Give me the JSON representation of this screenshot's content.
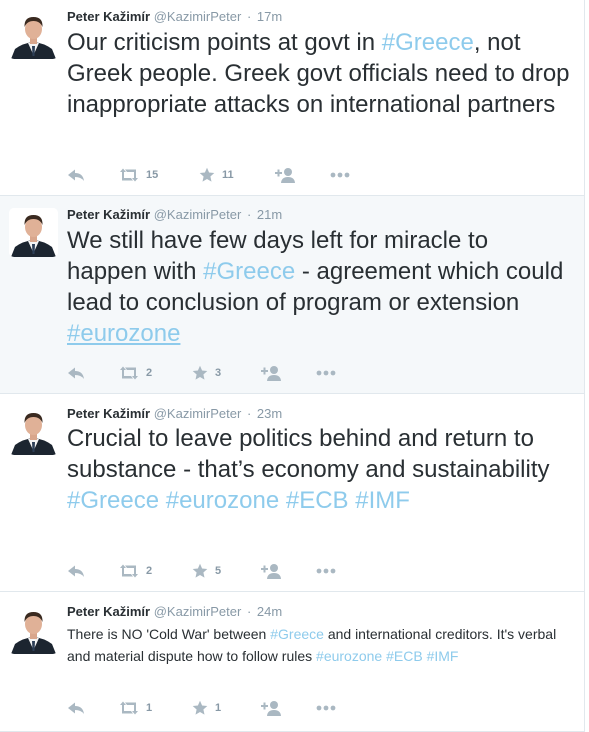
{
  "tweets": [
    {
      "name": "Peter Kažimír",
      "handle": "@KazimirPeter",
      "sep": "·",
      "time": "17m",
      "text": [
        {
          "t": "Our criticism points at govt in "
        },
        {
          "t": "#Greece",
          "tag": true
        },
        {
          "t": ", not Greek people. Greek govt officials need to drop inappropriate attacks on international partners"
        }
      ],
      "retweets": "15",
      "favorites": "11"
    },
    {
      "name": "Peter Kažimír",
      "handle": "@KazimirPeter",
      "sep": "·",
      "time": "21m",
      "text": [
        {
          "t": "We still have few days left for miracle to happen with "
        },
        {
          "t": "#Greece",
          "tag": true
        },
        {
          "t": " - agreement which could lead to conclusion of program or extension "
        },
        {
          "t": "#eurozone",
          "tag": true,
          "underline": true
        }
      ],
      "retweets": "2",
      "favorites": "3"
    },
    {
      "name": "Peter Kažimír",
      "handle": "@KazimirPeter",
      "sep": "·",
      "time": "23m",
      "text": [
        {
          "t": "Crucial to leave politics behind and return to substance - that’s economy and sustainability "
        },
        {
          "t": "#Greece",
          "tag": true
        },
        {
          "t": " "
        },
        {
          "t": "#eurozone",
          "tag": true
        },
        {
          "t": " "
        },
        {
          "t": "#ECB",
          "tag": true
        },
        {
          "t": " "
        },
        {
          "t": "#IMF",
          "tag": true
        }
      ],
      "retweets": "2",
      "favorites": "5"
    },
    {
      "name": "Peter Kažimír",
      "handle": "@KazimirPeter",
      "sep": "·",
      "time": "24m",
      "text": [
        {
          "t": "There is NO 'Cold War' between "
        },
        {
          "t": "#Greece",
          "tag": true
        },
        {
          "t": " and international creditors. It's verbal and material dispute how to follow rules "
        },
        {
          "t": "#eurozone",
          "tag": true
        },
        {
          "t": " "
        },
        {
          "t": "#ECB",
          "tag": true
        },
        {
          "t": " "
        },
        {
          "t": "#IMF",
          "tag": true
        }
      ],
      "retweets": "1",
      "favorites": "1"
    }
  ],
  "icons": [
    "reply-icon",
    "retweet-icon",
    "favorite-icon",
    "follow-icon",
    "more-icon"
  ],
  "colors": {
    "text": "#292f33",
    "muted": "#8899a6",
    "hashtag": "#8ecbec",
    "highlight_bg": "#f5f8fa",
    "border": "#e1e8ed",
    "icon": "#aab8c2"
  }
}
